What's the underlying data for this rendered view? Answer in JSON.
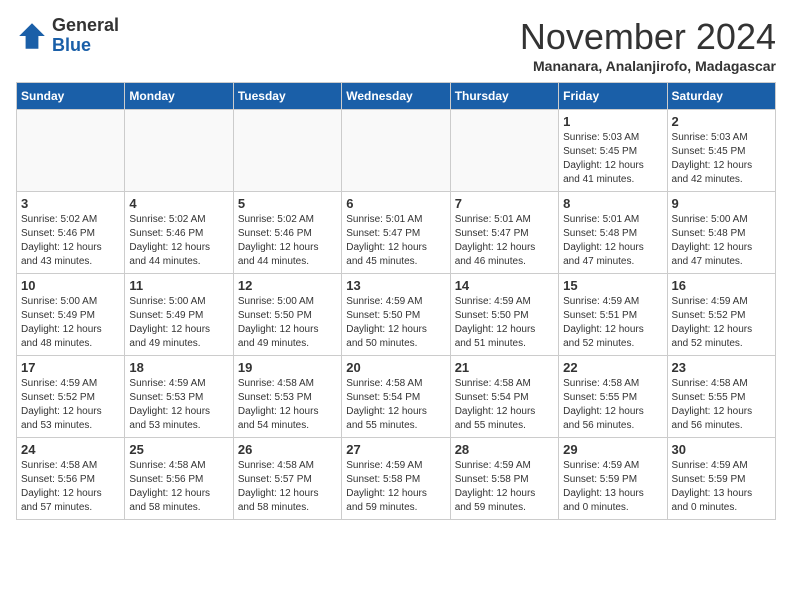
{
  "header": {
    "logo_general": "General",
    "logo_blue": "Blue",
    "month_title": "November 2024",
    "location": "Mananara, Analanjirofo, Madagascar"
  },
  "weekdays": [
    "Sunday",
    "Monday",
    "Tuesday",
    "Wednesday",
    "Thursday",
    "Friday",
    "Saturday"
  ],
  "weeks": [
    [
      {
        "day": "",
        "empty": true
      },
      {
        "day": "",
        "empty": true
      },
      {
        "day": "",
        "empty": true
      },
      {
        "day": "",
        "empty": true
      },
      {
        "day": "",
        "empty": true
      },
      {
        "day": "1",
        "sunrise": "5:03 AM",
        "sunset": "5:45 PM",
        "daylight": "12 hours and 41 minutes."
      },
      {
        "day": "2",
        "sunrise": "5:03 AM",
        "sunset": "5:45 PM",
        "daylight": "12 hours and 42 minutes."
      }
    ],
    [
      {
        "day": "3",
        "sunrise": "5:02 AM",
        "sunset": "5:46 PM",
        "daylight": "12 hours and 43 minutes."
      },
      {
        "day": "4",
        "sunrise": "5:02 AM",
        "sunset": "5:46 PM",
        "daylight": "12 hours and 44 minutes."
      },
      {
        "day": "5",
        "sunrise": "5:02 AM",
        "sunset": "5:46 PM",
        "daylight": "12 hours and 44 minutes."
      },
      {
        "day": "6",
        "sunrise": "5:01 AM",
        "sunset": "5:47 PM",
        "daylight": "12 hours and 45 minutes."
      },
      {
        "day": "7",
        "sunrise": "5:01 AM",
        "sunset": "5:47 PM",
        "daylight": "12 hours and 46 minutes."
      },
      {
        "day": "8",
        "sunrise": "5:01 AM",
        "sunset": "5:48 PM",
        "daylight": "12 hours and 47 minutes."
      },
      {
        "day": "9",
        "sunrise": "5:00 AM",
        "sunset": "5:48 PM",
        "daylight": "12 hours and 47 minutes."
      }
    ],
    [
      {
        "day": "10",
        "sunrise": "5:00 AM",
        "sunset": "5:49 PM",
        "daylight": "12 hours and 48 minutes."
      },
      {
        "day": "11",
        "sunrise": "5:00 AM",
        "sunset": "5:49 PM",
        "daylight": "12 hours and 49 minutes."
      },
      {
        "day": "12",
        "sunrise": "5:00 AM",
        "sunset": "5:50 PM",
        "daylight": "12 hours and 49 minutes."
      },
      {
        "day": "13",
        "sunrise": "4:59 AM",
        "sunset": "5:50 PM",
        "daylight": "12 hours and 50 minutes."
      },
      {
        "day": "14",
        "sunrise": "4:59 AM",
        "sunset": "5:50 PM",
        "daylight": "12 hours and 51 minutes."
      },
      {
        "day": "15",
        "sunrise": "4:59 AM",
        "sunset": "5:51 PM",
        "daylight": "12 hours and 52 minutes."
      },
      {
        "day": "16",
        "sunrise": "4:59 AM",
        "sunset": "5:52 PM",
        "daylight": "12 hours and 52 minutes."
      }
    ],
    [
      {
        "day": "17",
        "sunrise": "4:59 AM",
        "sunset": "5:52 PM",
        "daylight": "12 hours and 53 minutes."
      },
      {
        "day": "18",
        "sunrise": "4:59 AM",
        "sunset": "5:53 PM",
        "daylight": "12 hours and 53 minutes."
      },
      {
        "day": "19",
        "sunrise": "4:58 AM",
        "sunset": "5:53 PM",
        "daylight": "12 hours and 54 minutes."
      },
      {
        "day": "20",
        "sunrise": "4:58 AM",
        "sunset": "5:54 PM",
        "daylight": "12 hours and 55 minutes."
      },
      {
        "day": "21",
        "sunrise": "4:58 AM",
        "sunset": "5:54 PM",
        "daylight": "12 hours and 55 minutes."
      },
      {
        "day": "22",
        "sunrise": "4:58 AM",
        "sunset": "5:55 PM",
        "daylight": "12 hours and 56 minutes."
      },
      {
        "day": "23",
        "sunrise": "4:58 AM",
        "sunset": "5:55 PM",
        "daylight": "12 hours and 56 minutes."
      }
    ],
    [
      {
        "day": "24",
        "sunrise": "4:58 AM",
        "sunset": "5:56 PM",
        "daylight": "12 hours and 57 minutes."
      },
      {
        "day": "25",
        "sunrise": "4:58 AM",
        "sunset": "5:56 PM",
        "daylight": "12 hours and 58 minutes."
      },
      {
        "day": "26",
        "sunrise": "4:58 AM",
        "sunset": "5:57 PM",
        "daylight": "12 hours and 58 minutes."
      },
      {
        "day": "27",
        "sunrise": "4:59 AM",
        "sunset": "5:58 PM",
        "daylight": "12 hours and 59 minutes."
      },
      {
        "day": "28",
        "sunrise": "4:59 AM",
        "sunset": "5:58 PM",
        "daylight": "12 hours and 59 minutes."
      },
      {
        "day": "29",
        "sunrise": "4:59 AM",
        "sunset": "5:59 PM",
        "daylight": "13 hours and 0 minutes."
      },
      {
        "day": "30",
        "sunrise": "4:59 AM",
        "sunset": "5:59 PM",
        "daylight": "13 hours and 0 minutes."
      }
    ]
  ]
}
